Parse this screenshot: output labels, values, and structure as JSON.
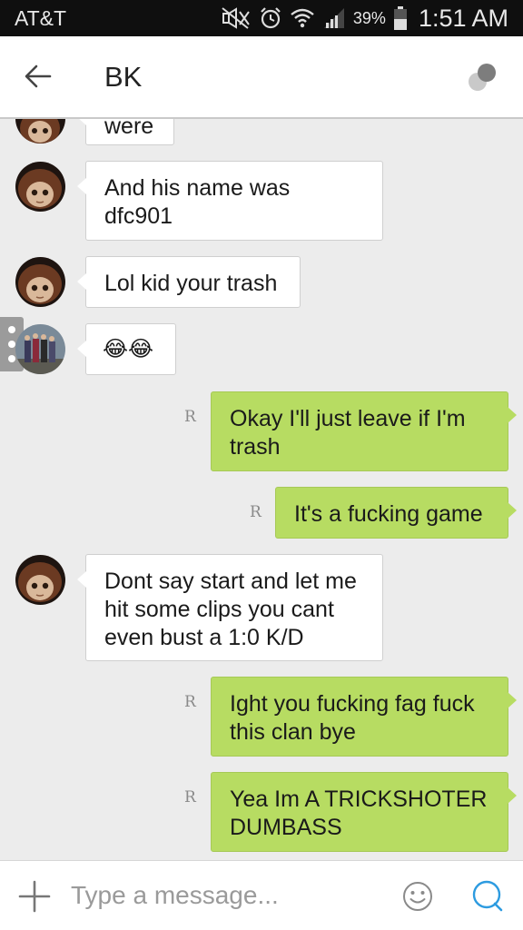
{
  "status_bar": {
    "carrier": "AT&T",
    "battery": "39%",
    "time": "1:51 AM",
    "icons": [
      "mute-icon",
      "alarm-icon",
      "wifi-icon",
      "signal-icon",
      "battery-icon"
    ]
  },
  "header": {
    "title": "BK",
    "back_icon": "arrow-left-icon",
    "menu_icon": "chat-menu-icon"
  },
  "messages": [
    {
      "direction": "in",
      "text": "were"
    },
    {
      "direction": "in",
      "text": "And his name was dfc901"
    },
    {
      "direction": "in",
      "text": "Lol kid your trash"
    },
    {
      "direction": "in",
      "text": "😂😂"
    },
    {
      "direction": "out",
      "text": "Okay I'll just leave if I'm trash",
      "read_mark": "R"
    },
    {
      "direction": "out",
      "text": "It's a fucking game",
      "read_mark": "R"
    },
    {
      "direction": "in",
      "text": "Dont say start and let me hit some clips you cant even bust a 1:0 K/D"
    },
    {
      "direction": "out",
      "text": "Ight you fucking fag fuck this clan bye",
      "read_mark": "R"
    },
    {
      "direction": "out",
      "text": "Yea Im A TRICKSHOTER DUMBASS",
      "read_mark": "R"
    }
  ],
  "composer": {
    "placeholder": "Type a message..."
  },
  "colors": {
    "outgoing_bubble": "#b7dc62",
    "incoming_bubble": "#ffffff",
    "accent": "#2d9be0",
    "status_bar": "#0f0f0f"
  }
}
